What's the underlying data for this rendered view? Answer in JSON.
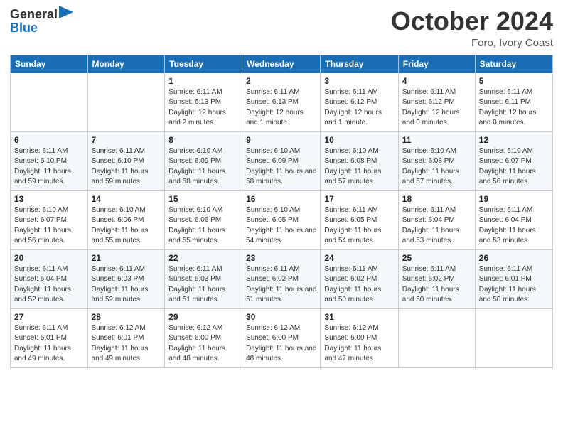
{
  "header": {
    "logo_line1": "General",
    "logo_line2": "Blue",
    "month_title": "October 2024",
    "location": "Foro, Ivory Coast"
  },
  "days_of_week": [
    "Sunday",
    "Monday",
    "Tuesday",
    "Wednesday",
    "Thursday",
    "Friday",
    "Saturday"
  ],
  "weeks": [
    [
      {
        "day": "",
        "info": ""
      },
      {
        "day": "",
        "info": ""
      },
      {
        "day": "1",
        "info": "Sunrise: 6:11 AM\nSunset: 6:13 PM\nDaylight: 12 hours and 2 minutes."
      },
      {
        "day": "2",
        "info": "Sunrise: 6:11 AM\nSunset: 6:13 PM\nDaylight: 12 hours and 1 minute."
      },
      {
        "day": "3",
        "info": "Sunrise: 6:11 AM\nSunset: 6:12 PM\nDaylight: 12 hours and 1 minute."
      },
      {
        "day": "4",
        "info": "Sunrise: 6:11 AM\nSunset: 6:12 PM\nDaylight: 12 hours and 0 minutes."
      },
      {
        "day": "5",
        "info": "Sunrise: 6:11 AM\nSunset: 6:11 PM\nDaylight: 12 hours and 0 minutes."
      }
    ],
    [
      {
        "day": "6",
        "info": "Sunrise: 6:11 AM\nSunset: 6:10 PM\nDaylight: 11 hours and 59 minutes."
      },
      {
        "day": "7",
        "info": "Sunrise: 6:11 AM\nSunset: 6:10 PM\nDaylight: 11 hours and 59 minutes."
      },
      {
        "day": "8",
        "info": "Sunrise: 6:10 AM\nSunset: 6:09 PM\nDaylight: 11 hours and 58 minutes."
      },
      {
        "day": "9",
        "info": "Sunrise: 6:10 AM\nSunset: 6:09 PM\nDaylight: 11 hours and 58 minutes."
      },
      {
        "day": "10",
        "info": "Sunrise: 6:10 AM\nSunset: 6:08 PM\nDaylight: 11 hours and 57 minutes."
      },
      {
        "day": "11",
        "info": "Sunrise: 6:10 AM\nSunset: 6:08 PM\nDaylight: 11 hours and 57 minutes."
      },
      {
        "day": "12",
        "info": "Sunrise: 6:10 AM\nSunset: 6:07 PM\nDaylight: 11 hours and 56 minutes."
      }
    ],
    [
      {
        "day": "13",
        "info": "Sunrise: 6:10 AM\nSunset: 6:07 PM\nDaylight: 11 hours and 56 minutes."
      },
      {
        "day": "14",
        "info": "Sunrise: 6:10 AM\nSunset: 6:06 PM\nDaylight: 11 hours and 55 minutes."
      },
      {
        "day": "15",
        "info": "Sunrise: 6:10 AM\nSunset: 6:06 PM\nDaylight: 11 hours and 55 minutes."
      },
      {
        "day": "16",
        "info": "Sunrise: 6:10 AM\nSunset: 6:05 PM\nDaylight: 11 hours and 54 minutes."
      },
      {
        "day": "17",
        "info": "Sunrise: 6:11 AM\nSunset: 6:05 PM\nDaylight: 11 hours and 54 minutes."
      },
      {
        "day": "18",
        "info": "Sunrise: 6:11 AM\nSunset: 6:04 PM\nDaylight: 11 hours and 53 minutes."
      },
      {
        "day": "19",
        "info": "Sunrise: 6:11 AM\nSunset: 6:04 PM\nDaylight: 11 hours and 53 minutes."
      }
    ],
    [
      {
        "day": "20",
        "info": "Sunrise: 6:11 AM\nSunset: 6:04 PM\nDaylight: 11 hours and 52 minutes."
      },
      {
        "day": "21",
        "info": "Sunrise: 6:11 AM\nSunset: 6:03 PM\nDaylight: 11 hours and 52 minutes."
      },
      {
        "day": "22",
        "info": "Sunrise: 6:11 AM\nSunset: 6:03 PM\nDaylight: 11 hours and 51 minutes."
      },
      {
        "day": "23",
        "info": "Sunrise: 6:11 AM\nSunset: 6:02 PM\nDaylight: 11 hours and 51 minutes."
      },
      {
        "day": "24",
        "info": "Sunrise: 6:11 AM\nSunset: 6:02 PM\nDaylight: 11 hours and 50 minutes."
      },
      {
        "day": "25",
        "info": "Sunrise: 6:11 AM\nSunset: 6:02 PM\nDaylight: 11 hours and 50 minutes."
      },
      {
        "day": "26",
        "info": "Sunrise: 6:11 AM\nSunset: 6:01 PM\nDaylight: 11 hours and 50 minutes."
      }
    ],
    [
      {
        "day": "27",
        "info": "Sunrise: 6:11 AM\nSunset: 6:01 PM\nDaylight: 11 hours and 49 minutes."
      },
      {
        "day": "28",
        "info": "Sunrise: 6:12 AM\nSunset: 6:01 PM\nDaylight: 11 hours and 49 minutes."
      },
      {
        "day": "29",
        "info": "Sunrise: 6:12 AM\nSunset: 6:00 PM\nDaylight: 11 hours and 48 minutes."
      },
      {
        "day": "30",
        "info": "Sunrise: 6:12 AM\nSunset: 6:00 PM\nDaylight: 11 hours and 48 minutes."
      },
      {
        "day": "31",
        "info": "Sunrise: 6:12 AM\nSunset: 6:00 PM\nDaylight: 11 hours and 47 minutes."
      },
      {
        "day": "",
        "info": ""
      },
      {
        "day": "",
        "info": ""
      }
    ]
  ]
}
